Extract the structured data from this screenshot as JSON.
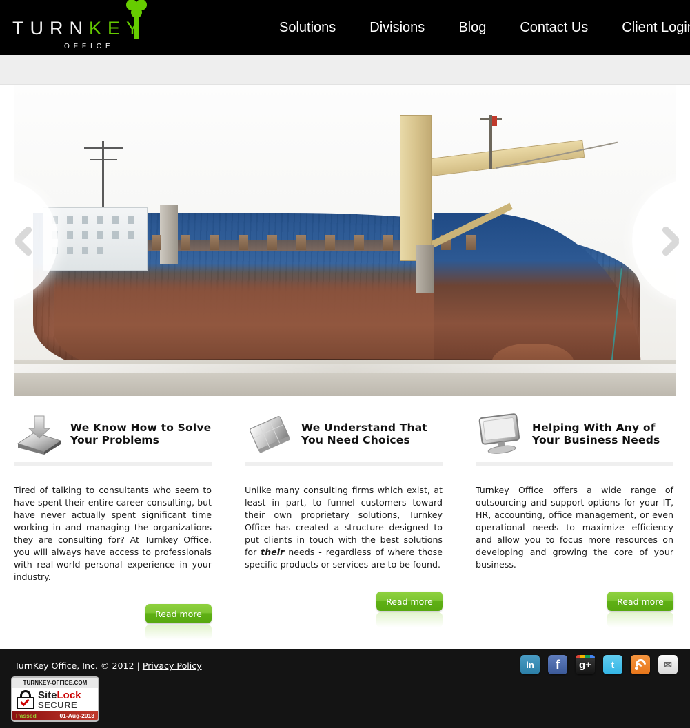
{
  "header": {
    "logo": {
      "word_dark": "TURN",
      "word_green": "KEY",
      "subtitle": "OFFICE",
      "key_icon": "key-icon"
    },
    "nav": [
      {
        "label": "Solutions"
      },
      {
        "label": "Divisions"
      },
      {
        "label": "Blog"
      },
      {
        "label": "Contact Us"
      },
      {
        "label": "Client Login"
      }
    ]
  },
  "slider": {
    "prev_label": "Previous slide",
    "next_label": "Next slide",
    "image_alt": "Rusted blue and brown cargo ship with yellow crane beached on shore"
  },
  "features": [
    {
      "icon": "document-download-icon",
      "title": "We Know How to Solve Your Problems",
      "body_pre": "Tired of talking to consultants who seem to have spent their entire career consulting, but have never actually spent significant time working in and managing the organizations they are consulting for?  At Turnkey Office, you will always have access to professionals with real-world personal experience in your industry.",
      "body_em": "",
      "body_post": "",
      "button": "Read more"
    },
    {
      "icon": "tilted-book-icon",
      "title": "We Understand  That You Need Choices",
      "body_pre": "Unlike many consulting firms which exist, at least in part, to funnel customers toward their own proprietary solutions, Turnkey Office has created a structure designed to put clients in touch with the best solutions for ",
      "body_em": "their",
      "body_post": " needs - regardless of where those specific products or services are to be found.",
      "button": "Read more"
    },
    {
      "icon": "computer-monitor-icon",
      "title": "Helping With Any of Your Business Needs",
      "body_pre": "Turnkey Office offers a wide range of outsourcing and support options for your IT, HR, accounting, office management, or even operational needs to maximize efficiency and allow you to focus more resources on developing and growing the core of your business.",
      "body_em": "",
      "body_post": "",
      "button": "Read more"
    }
  ],
  "footer": {
    "copyright": "TurnKey Office, Inc. © 2012 | ",
    "privacy_link": "Privacy Policy",
    "sitelock": {
      "domain": "TURNKEY-OFFICE.COM",
      "brand_site": "Site",
      "brand_lock": "Lock",
      "secure": "SECURE",
      "status": "Passed",
      "date": "01-Aug-2013"
    },
    "social": [
      {
        "name": "linkedin",
        "glyph": "in"
      },
      {
        "name": "facebook",
        "glyph": "f"
      },
      {
        "name": "googleplus",
        "glyph": "g+"
      },
      {
        "name": "twitter",
        "glyph": "t"
      },
      {
        "name": "rss",
        "glyph": ""
      },
      {
        "name": "email",
        "glyph": "✉"
      }
    ]
  },
  "colors": {
    "brand_green": "#66cc00",
    "button_green": "#7ec633",
    "header_black": "#000000",
    "footer_black": "#141414",
    "subbar_gray": "#eeeeee"
  }
}
